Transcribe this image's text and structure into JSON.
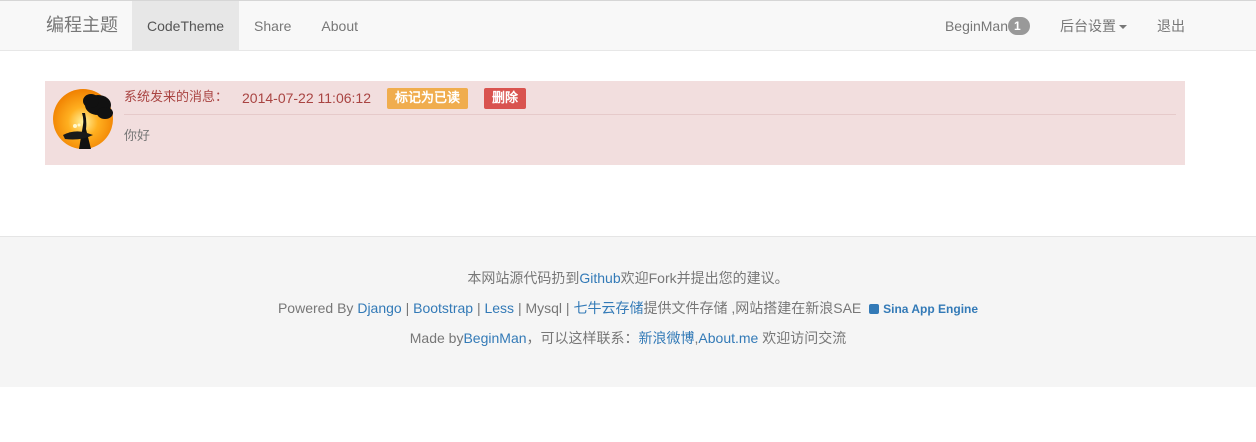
{
  "navbar": {
    "brand": "编程主题",
    "left_items": [
      "CodeTheme",
      "Share",
      "About"
    ],
    "user": "BeginMan",
    "badge_count": "1",
    "settings": "后台设置",
    "logout": "退出"
  },
  "message": {
    "sender_label": "系统发来的消息：",
    "time": "2014-07-22 11:06:12",
    "mark_read": "标记为已读",
    "delete": "删除",
    "body": "你好"
  },
  "footer": {
    "line1_pre": "本网站源代码扔到",
    "line1_link": "Github",
    "line1_post": "欢迎Fork并提出您的建议。",
    "line2_powered": "Powered By ",
    "line2_django": "Django",
    "line2_sep1": " | ",
    "line2_bootstrap": "Bootstrap",
    "line2_sep2": " | ",
    "line2_less": "Less",
    "line2_mysql": " | Mysql | ",
    "line2_qiniu": "七牛云存储",
    "line2_post": "提供文件存储 ,网站搭建在新浪SAE",
    "line2_sae": "Sina App Engine",
    "line3_pre": "Made by",
    "line3_user": "BeginMan",
    "line3_mid": "，可以这样联系：",
    "line3_weibo": "新浪微博",
    "line3_comma": ",",
    "line3_aboutme": "About.me",
    "line3_post": " 欢迎访问交流"
  },
  "colors": {
    "alert_bg": "#f2dede",
    "alert_text": "#a94442",
    "warning": "#f0ad4e",
    "danger": "#d9534f",
    "link": "#337ab7"
  }
}
